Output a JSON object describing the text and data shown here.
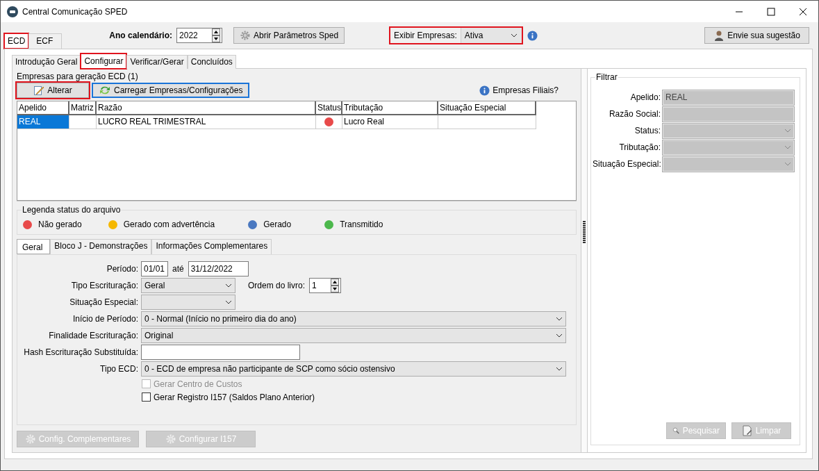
{
  "window": {
    "title": "Central Comunicação SPED"
  },
  "outer_tabs": [
    {
      "label": "ECD",
      "selected": true,
      "highlighted": true
    },
    {
      "label": "ECF",
      "selected": false,
      "highlighted": false
    }
  ],
  "year": {
    "label": "Ano calendário:",
    "value": "2022"
  },
  "params_button": {
    "label": "Abrir Parâmetros Sped"
  },
  "show_companies": {
    "label": "Exibir Empresas:",
    "value": "Ativa",
    "highlighted": true
  },
  "suggestion_button": {
    "label": "Envie sua sugestão"
  },
  "inner_tabs": [
    {
      "label": "Introdução Geral",
      "selected": false,
      "highlighted": false
    },
    {
      "label": "Configurar",
      "selected": true,
      "highlighted": true
    },
    {
      "label": "Verificar/Gerar",
      "selected": false,
      "highlighted": false
    },
    {
      "label": "Concluídos",
      "selected": false,
      "highlighted": false
    }
  ],
  "companies": {
    "title": "Empresas para geração ECD (1)",
    "buttons": [
      {
        "label": "Alterar",
        "kind": "edit",
        "highlighted": true,
        "focused": false
      },
      {
        "label": "Carregar Empresas/Configurações",
        "kind": "reload",
        "highlighted": false,
        "focused": true
      }
    ],
    "filiais_link": "Empresas Filiais?",
    "columns": [
      "Apelido",
      "Matriz",
      "Razão",
      "Status",
      "Tributação",
      "Situação Especial"
    ],
    "rows": [
      {
        "apelido": "REAL",
        "razao": "LUCRO REAL TRIMESTRAL",
        "color": "#e84a4a",
        "tributacao": "Lucro Real",
        "selected": true
      }
    ]
  },
  "legend": {
    "title": "Legenda status do arquivo",
    "items": [
      {
        "label": "Não gerado",
        "color": "#e84a4a"
      },
      {
        "label": "Gerado com advertência",
        "color": "#f5b800"
      },
      {
        "label": "Gerado",
        "color": "#4a78c0"
      },
      {
        "label": "Transmitido",
        "color": "#4cb84c"
      }
    ]
  },
  "sub_tabs": [
    {
      "label": "Geral",
      "selected": true
    },
    {
      "label": "Bloco J - Demonstrações",
      "selected": false
    },
    {
      "label": "Informações Complementares",
      "selected": false
    }
  ],
  "form": {
    "periodo": {
      "label": "Período:",
      "from": "01/01",
      "sep": "até",
      "to": "31/12/2022"
    },
    "tipo_escrituracao": {
      "label": "Tipo Escrituração:",
      "value": "Geral"
    },
    "ordem": {
      "label": "Ordem do livro:",
      "value": "1"
    },
    "situacao_especial": {
      "label": "Situação Especial:"
    },
    "inicio": {
      "label": "Início de Período:",
      "value": "0 - Normal (Início no primeiro dia do ano)"
    },
    "finalidade": {
      "label": "Finalidade Escrituração:",
      "value": "Original"
    },
    "hash": {
      "label": "Hash Escrituração Substituída:"
    },
    "tipo_ecd": {
      "label": "Tipo ECD:",
      "value": "0 - ECD de empresa não participante de SCP como sócio ostensivo"
    },
    "checkboxes": [
      {
        "label": "Gerar Centro de Custos",
        "checked": false,
        "disabled": true
      },
      {
        "label": "Gerar Registro I157 (Saldos Plano Anterior)",
        "checked": false,
        "disabled": false
      }
    ]
  },
  "bottom_buttons": [
    {
      "label": "Config. Complementares",
      "disabled": true
    },
    {
      "label": "Configurar I157",
      "disabled": true
    }
  ],
  "filter": {
    "title": "Filtrar",
    "fields": [
      {
        "label": "Apelido:",
        "kind": "text",
        "value": "REAL"
      },
      {
        "label": "Razão Social:",
        "kind": "text"
      },
      {
        "label": "Status:",
        "kind": "select"
      },
      {
        "label": "Tributação:",
        "kind": "select"
      },
      {
        "label": "Situação Especial:",
        "kind": "select"
      }
    ],
    "buttons": [
      {
        "label": "Pesquisar",
        "kind": "search",
        "disabled": true
      },
      {
        "label": "Limpar",
        "kind": "clear",
        "disabled": true
      }
    ]
  }
}
